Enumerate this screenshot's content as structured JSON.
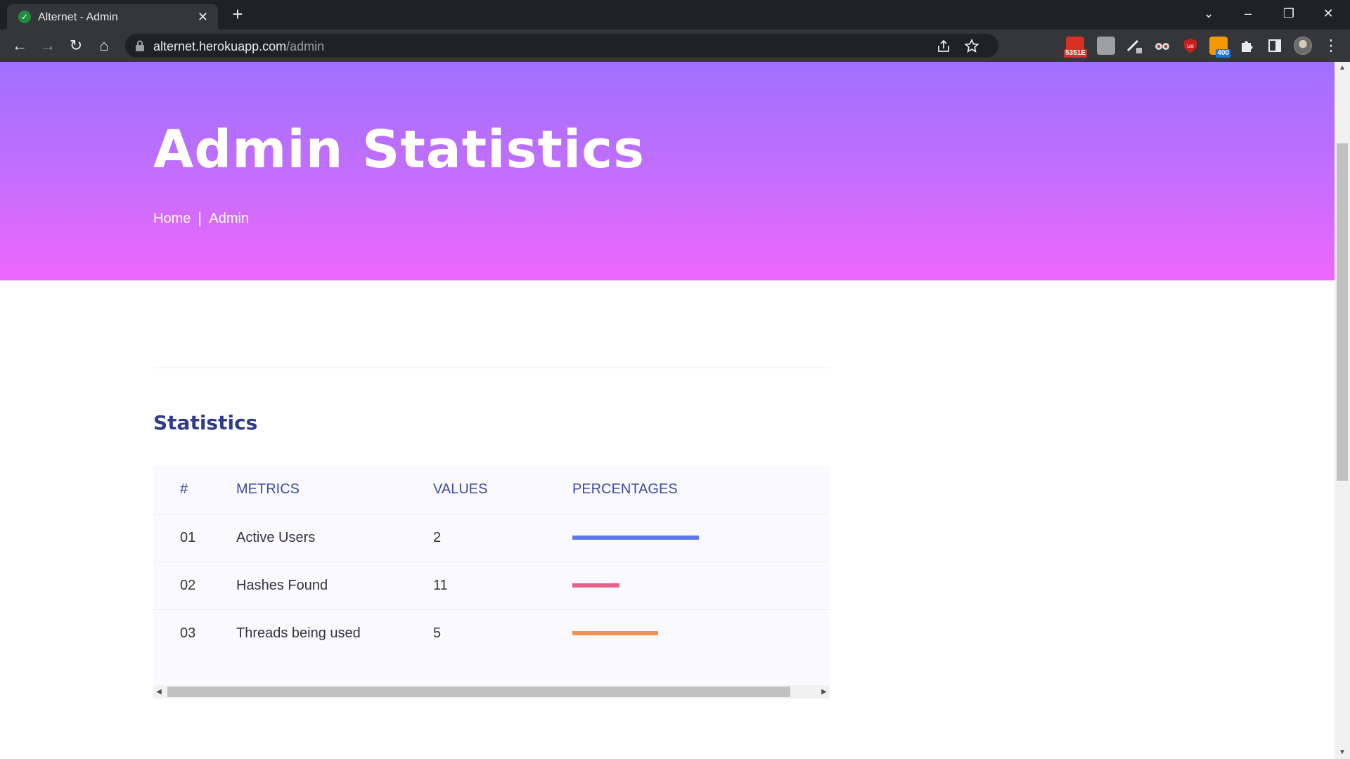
{
  "browser": {
    "tab_title": "Alternet - Admin",
    "tab_close": "✕",
    "new_tab": "+",
    "url_host": "alternet.herokuapp.com",
    "url_path": "/admin",
    "window_controls": {
      "tabs_dropdown": "⌄",
      "minimize": "–",
      "restore": "❐",
      "close": "✕"
    },
    "nav": {
      "back": "←",
      "forward": "→",
      "reload": "↻",
      "home": "⌂"
    },
    "extensions": [
      {
        "name": "gmail-checker",
        "badge": "5351E",
        "color": "#d93025",
        "badge_color": "#d93025"
      },
      {
        "name": "extension-gray",
        "badge": "",
        "color": "#9aa0a6",
        "badge_color": ""
      },
      {
        "name": "extension-pen",
        "badge": "",
        "color": "#e8eaed",
        "badge_color": ""
      },
      {
        "name": "extension-glasses",
        "badge": "",
        "color": "#e8eaed",
        "badge_color": ""
      },
      {
        "name": "ublock",
        "badge": "",
        "color": "#c5221f",
        "badge_color": ""
      },
      {
        "name": "rss-feed",
        "badge": "400",
        "color": "#f29900",
        "badge_color": "#1a73e8"
      }
    ]
  },
  "hero": {
    "title": "Admin Statistics",
    "breadcrumb": {
      "home": "Home",
      "current": "Admin"
    }
  },
  "statistics": {
    "title": "Statistics",
    "columns": [
      "#",
      "METRICS",
      "VALUES",
      "PERCENTAGES"
    ],
    "rows": [
      {
        "num": "01",
        "metric": "Active Users",
        "value": "2",
        "percentage": 0.62,
        "color": "#5a78e6"
      },
      {
        "num": "02",
        "metric": "Hashes Found",
        "value": "11",
        "percentage": 0.23,
        "color": "#e5638a"
      },
      {
        "num": "03",
        "metric": "Threads being used",
        "value": "5",
        "percentage": 0.42,
        "color": "#ef9354"
      }
    ]
  }
}
